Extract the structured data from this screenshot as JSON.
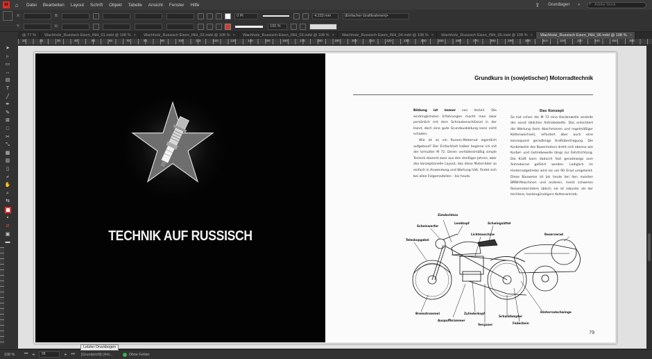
{
  "app": {
    "logo_text": "Id",
    "menu": [
      "Datei",
      "Bearbeiten",
      "Layout",
      "Schrift",
      "Objekt",
      "Tabelle",
      "Ansicht",
      "Fenster",
      "Hilfe"
    ],
    "workspace": "Grundlagen",
    "search_placeholder": "Adobe Stock"
  },
  "control": {
    "x_label": "X:",
    "y_label": "Y:",
    "w_label": "B:",
    "h_label": "H:",
    "stroke_weight": "0 Pt",
    "width_value": "4,233 mm",
    "opacity": "100 %",
    "object_style": "[Einfacher Grafikrahmen]+",
    "stroke_color": "#ffffff",
    "fill_color": "#d33a2f"
  },
  "tabs": [
    {
      "label": "@ 77 %",
      "active": false
    },
    {
      "label": "Wachholz_Russisch Eisen_INH_01.indd @ 108 %",
      "active": false
    },
    {
      "label": "Wachholz_Russisch Eisen_INH_02.indd @ 108 %",
      "active": false
    },
    {
      "label": "Wachholz_Russisch Eisen_INH_03.indd @ 108 %",
      "active": false
    },
    {
      "label": "Wachholz_Russisch Eisen_INH_04.indd @ 108 %",
      "active": false
    },
    {
      "label": "Wachholz_Russisch Eisen_INH_05.indd @ 108 %",
      "active": false
    },
    {
      "label": "Wachholz_Russisch Eisen_INH_06.indd @ 108 %",
      "active": true
    }
  ],
  "ruler_numbers": [
    "10",
    "20",
    "30",
    "40",
    "50",
    "60",
    "70",
    "80",
    "90",
    "100",
    "110",
    "120",
    "130",
    "140",
    "150",
    "160",
    "170",
    "180",
    "190",
    "200",
    "210",
    "220",
    "230",
    "240",
    "250",
    "260",
    "270",
    "280",
    "290",
    "300",
    "310",
    "320",
    "330",
    "340",
    "350",
    "360"
  ],
  "left_page": {
    "title": "TECHNIK AUF RUSSISCH"
  },
  "right_page": {
    "heading": "Grundkurs in (sowjetischer) Motorradtechnik",
    "col1_lead": "Bildung ist immer",
    "col1_p1_rest": " von Vorteil. Die eindringlichsten Erfahrungen macht man zwar persönlich mit dem Schraubenschlüssel in der Hand, doch eine gute Grundausbildung kann nicht schaden.",
    "col1_p2": "Wie ist so ein Russen-Motorrad eigentlich aufgebaut? Der Einfachheit halber beginne ich mit der Urmutter M 72. Deren verhältnismäßig simple Technik stammt zwar aus den dreißiger Jahren, aber das konzeptionelle Layout, das diese Motorräder so einfach in Anwendung und Wartung hält, findet sich bei allen Folgemodellen – bis heute.",
    "col2_heading": "Das Konzept",
    "col2_p1": "So hat schon die M 72 eine Kardanwelle anstelle der sonst üblichen Antriebskette. Das erleichtert die Wartung (kein Abschmieren und regelmäßiger Kettenwechsel), erfordert aber auch eine konsequent geradlinige Kraftübertragung. Die Kurbelwelle des Boxermotors dreht sich ebenso wie Kurbel- und Getriebewelle längs zur Fahrtrichtung. Die Kraft kann dadurch fast geradewegs zum Antriebsrad geführt werden. Lediglich im Hinterradgetriebe wird sie um 90 Grad umgelenkt. Diese Bauweise ist bis heute bei den meisten BMW-Maschinen und anderen, meist schweren Reisemotorrädern üblich; sie ist robuster als der leichtere, kostengünstigere Kettenantrieb.",
    "diagram_labels": {
      "zuendschloss": "Zündschloss",
      "scheinwerfer": "Scheinwerfer",
      "lenkkopf": "Lenkkopf",
      "schwingsattel": "Schwingsättel",
      "lichtmaschine": "Lichtmaschine",
      "reserverad": "Reserverad",
      "teleskopgabel": "Teleskopgabel",
      "bremstrommel": "Bremstrommel",
      "zylinderkopf": "Zylinderkopf",
      "schalldaempfer": "Schalldämpfer",
      "hinterradschwinge": "Hinterradschwinge",
      "auspuffkruemmer": "Auspuffkrümmer",
      "vergaser": "Vergaser",
      "federbein": "Federbein"
    },
    "page_number": "79"
  },
  "status": {
    "zoom": "108 %",
    "page": "78",
    "master": "[Grundprofil] (Arb...",
    "errors": "Ohne Fehler",
    "tooltip": "Letzter Druckbogen"
  }
}
